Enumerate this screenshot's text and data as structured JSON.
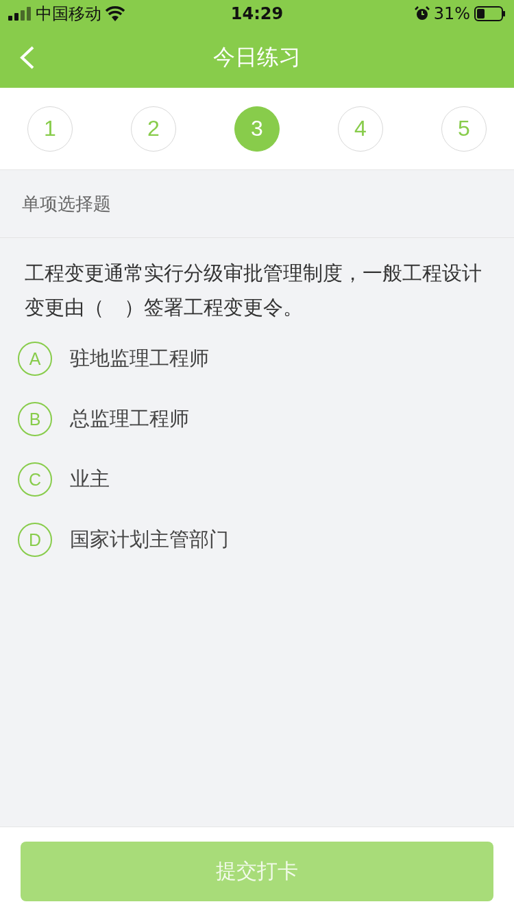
{
  "status_bar": {
    "carrier": "中国移动",
    "time": "14:29",
    "battery": "31%"
  },
  "nav": {
    "title": "今日练习"
  },
  "tabs": [
    {
      "label": "1",
      "selected": false
    },
    {
      "label": "2",
      "selected": false
    },
    {
      "label": "3",
      "selected": true
    },
    {
      "label": "4",
      "selected": false
    },
    {
      "label": "5",
      "selected": false
    }
  ],
  "question": {
    "type": "单项选择题",
    "text": "工程变更通常实行分级审批管理制度，一般工程设计变更由（　）签署工程变更令。",
    "options": [
      {
        "letter": "A",
        "text": "驻地监理工程师",
        "selected": false
      },
      {
        "letter": "B",
        "text": "总监理工程师",
        "selected": false
      },
      {
        "letter": "C",
        "text": "业主",
        "selected": false
      },
      {
        "letter": "D",
        "text": "国家计划主管部门",
        "selected": false
      }
    ]
  },
  "submit": {
    "label": "提交打卡",
    "disabled": true
  }
}
